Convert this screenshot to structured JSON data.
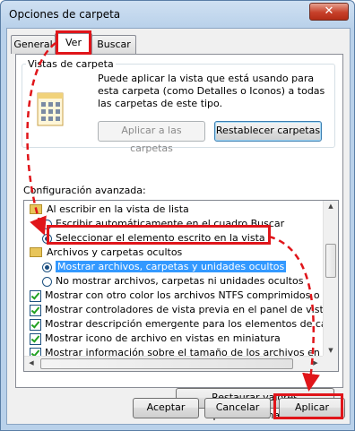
{
  "window": {
    "title": "Opciones de carpeta",
    "close_symbol": "✕"
  },
  "tabs": [
    {
      "label": "General"
    },
    {
      "label": "Ver"
    },
    {
      "label": "Buscar"
    }
  ],
  "folder_views": {
    "legend": "Vistas de carpeta",
    "description": "Puede aplicar la vista que está usando para esta carpeta (como Detalles o Iconos) a todas las carpetas de este tipo.",
    "apply_button": "Aplicar a las carpetas",
    "reset_button": "Restablecer carpetas"
  },
  "advanced": {
    "label": "Configuración avanzada:",
    "items": [
      {
        "type": "folder",
        "text": "Al escribir en la vista de lista"
      },
      {
        "type": "radio",
        "checked": false,
        "text": "Escribir automáticamente en el cuadro Buscar"
      },
      {
        "type": "radio",
        "checked": true,
        "text": "Seleccionar el elemento escrito en la vista"
      },
      {
        "type": "folder",
        "text": "Archivos y carpetas ocultos"
      },
      {
        "type": "radio",
        "checked": true,
        "selected": true,
        "text": "Mostrar archivos, carpetas y unidades ocultos"
      },
      {
        "type": "radio",
        "checked": false,
        "text": "No mostrar archivos, carpetas ni unidades ocultos"
      },
      {
        "type": "check",
        "checked": true,
        "text": "Mostrar con otro color los archivos NTFS comprimidos o cifra"
      },
      {
        "type": "check",
        "checked": true,
        "text": "Mostrar controladores de vista previa en el panel de vista pre"
      },
      {
        "type": "check",
        "checked": true,
        "text": "Mostrar descripción emergente para los elementos de carpet"
      },
      {
        "type": "check",
        "checked": true,
        "text": "Mostrar icono de archivo en vistas en miniatura"
      },
      {
        "type": "check",
        "checked": true,
        "text": "Mostrar información sobre el tamaño de los archivos en suge"
      }
    ]
  },
  "restore_button": "Restaurar valores predeterminados",
  "dialog_buttons": {
    "ok": "Aceptar",
    "cancel": "Cancelar",
    "apply": "Aplicar"
  },
  "colors": {
    "annotation_red": "#e0151a",
    "selection": "#3399ff"
  }
}
